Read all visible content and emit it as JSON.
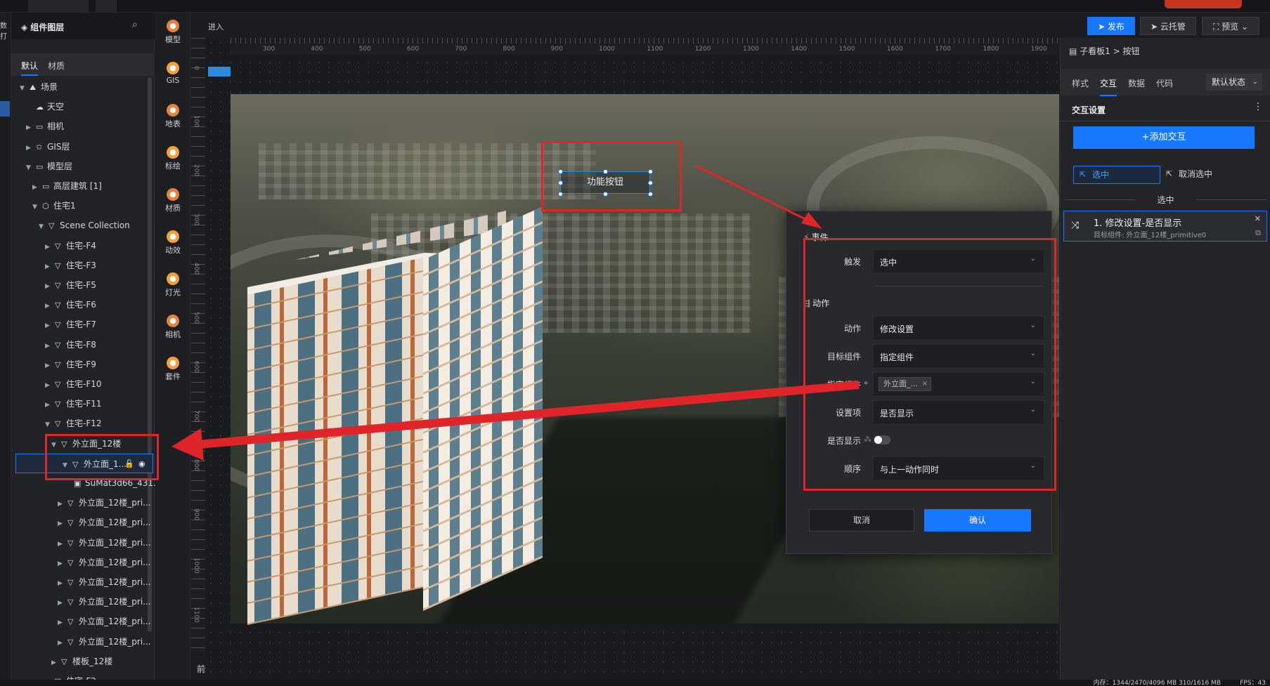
{
  "top": {
    "badge": ""
  },
  "left_strip": {
    "label": "数打"
  },
  "layer_panel": {
    "title": "组件图层",
    "tabs": [
      "默认",
      "材质"
    ],
    "tree": [
      {
        "label": "场景",
        "icon": "scene-icon",
        "indent": 0,
        "arrow": "down"
      },
      {
        "label": "天空",
        "icon": "sky-icon",
        "indent": 1,
        "arrow": ""
      },
      {
        "label": "相机",
        "icon": "folder-icon",
        "indent": 1,
        "arrow": "right"
      },
      {
        "label": "GIS层",
        "icon": "gis-icon",
        "indent": 1,
        "arrow": "right"
      },
      {
        "label": "模型层",
        "icon": "folder-icon",
        "indent": 1,
        "arrow": "down"
      },
      {
        "label": "高层建筑 [1]",
        "icon": "folder-icon",
        "indent": 2,
        "arrow": "right"
      },
      {
        "label": "住宅1",
        "icon": "model-icon",
        "indent": 2,
        "arrow": "down"
      },
      {
        "label": "Scene Collection",
        "icon": "collection-icon",
        "indent": 3,
        "arrow": "down"
      },
      {
        "label": "住宅-F4",
        "icon": "collection-icon",
        "indent": 4,
        "arrow": "right"
      },
      {
        "label": "住宅-F3",
        "icon": "collection-icon",
        "indent": 4,
        "arrow": "right"
      },
      {
        "label": "住宅-F5",
        "icon": "collection-icon",
        "indent": 4,
        "arrow": "right"
      },
      {
        "label": "住宅-F6",
        "icon": "collection-icon",
        "indent": 4,
        "arrow": "right"
      },
      {
        "label": "住宅-F7",
        "icon": "collection-icon",
        "indent": 4,
        "arrow": "right"
      },
      {
        "label": "住宅-F8",
        "icon": "collection-icon",
        "indent": 4,
        "arrow": "right"
      },
      {
        "label": "住宅-F9",
        "icon": "collection-icon",
        "indent": 4,
        "arrow": "right"
      },
      {
        "label": "住宅-F10",
        "icon": "collection-icon",
        "indent": 4,
        "arrow": "right"
      },
      {
        "label": "住宅-F11",
        "icon": "collection-icon",
        "indent": 4,
        "arrow": "right"
      },
      {
        "label": "住宅-F12",
        "icon": "collection-icon",
        "indent": 4,
        "arrow": "down"
      },
      {
        "label": "外立面_12楼",
        "icon": "collection-icon",
        "indent": 5,
        "arrow": "down"
      },
      {
        "label": "外立面_1...",
        "icon": "collection-icon",
        "indent": 6,
        "arrow": "down",
        "selected": true
      },
      {
        "label": "SuMat3d66_431...",
        "icon": "material-icon",
        "indent": 7,
        "arrow": ""
      },
      {
        "label": "外立面_12楼_pri...",
        "icon": "collection-icon",
        "indent": 6,
        "arrow": "right"
      },
      {
        "label": "外立面_12楼_pri...",
        "icon": "collection-icon",
        "indent": 6,
        "arrow": "right"
      },
      {
        "label": "外立面_12楼_pri...",
        "icon": "collection-icon",
        "indent": 6,
        "arrow": "right"
      },
      {
        "label": "外立面_12楼_pri...",
        "icon": "collection-icon",
        "indent": 6,
        "arrow": "right"
      },
      {
        "label": "外立面_12楼_pri...",
        "icon": "collection-icon",
        "indent": 6,
        "arrow": "right"
      },
      {
        "label": "外立面_12楼_pri...",
        "icon": "collection-icon",
        "indent": 6,
        "arrow": "right"
      },
      {
        "label": "外立面_12楼_pri...",
        "icon": "collection-icon",
        "indent": 6,
        "arrow": "right"
      },
      {
        "label": "外立面_12楼_pri...",
        "icon": "collection-icon",
        "indent": 6,
        "arrow": "right"
      },
      {
        "label": "楼板_12楼",
        "icon": "collection-icon",
        "indent": 5,
        "arrow": "right"
      },
      {
        "label": "住宅-F2",
        "icon": "collection-icon",
        "indent": 4,
        "arrow": "right"
      }
    ]
  },
  "toolbar": {
    "items": [
      {
        "label": "模型",
        "icon": "model-tool-icon",
        "color": "#e8803a"
      },
      {
        "label": "GIS",
        "icon": "gis-tool-icon",
        "color": "#f0a13c"
      },
      {
        "label": "地表",
        "icon": "terrain-tool-icon",
        "color": "#e8803a"
      },
      {
        "label": "标绘",
        "icon": "marker-tool-icon",
        "color": "#f0a13c"
      },
      {
        "label": "材质",
        "icon": "material-tool-icon",
        "color": "#e8803a"
      },
      {
        "label": "动效",
        "icon": "effect-tool-icon",
        "color": "#f0a13c"
      },
      {
        "label": "灯光",
        "icon": "light-tool-icon",
        "color": "#f0a13c"
      },
      {
        "label": "相机",
        "icon": "camera-tool-icon",
        "color": "#e8803a"
      },
      {
        "label": "套件",
        "icon": "kit-tool-icon",
        "color": "#f0a13c"
      }
    ]
  },
  "mini_panel": {
    "title": "进入",
    "footer": "前景"
  },
  "rulers": {
    "h_labels": [
      "300",
      "400",
      "500",
      "600",
      "700",
      "800",
      "900",
      "1000",
      "1100",
      "1200",
      "1300",
      "1400",
      "1500",
      "1600",
      "1700",
      "1800",
      "1900"
    ],
    "v_labels": [
      "0",
      "100",
      "200",
      "300",
      "400",
      "500",
      "600",
      "700",
      "800",
      "900",
      "1000",
      "1100"
    ]
  },
  "canvas": {
    "function_button": "功能按钮"
  },
  "dialog": {
    "event_section": "事件",
    "action_section": "动作",
    "fields": {
      "trigger": {
        "label": "触发",
        "value": "选中"
      },
      "action": {
        "label": "动作",
        "value": "修改设置"
      },
      "target": {
        "label": "目标组件",
        "value": "指定组件"
      },
      "specified": {
        "label": "指定组件",
        "tag": "外立面_..."
      },
      "setting": {
        "label": "设置项",
        "value": "是否显示"
      },
      "show": {
        "label": "是否显示",
        "state": "off"
      },
      "order": {
        "label": "顺序",
        "value": "与上一动作同时"
      }
    },
    "cancel": "取消",
    "confirm": "确认"
  },
  "actions": {
    "publish": "发布",
    "cloud": "云托管",
    "preview": "预览"
  },
  "right_panel": {
    "breadcrumb": "子看板1 > 按钮",
    "tabs": [
      "样式",
      "交互",
      "数据",
      "代码"
    ],
    "active_tab": "交互",
    "state": "默认状态",
    "section_title": "交互设置",
    "add_button": "+添加交互",
    "select_option": "选中",
    "deselect_option": "取消选中",
    "group_label": "选中",
    "action_card": {
      "title": "1. 修改设置-是否显示",
      "subtitle": "目标组件: 外立面_12楼_primitive0"
    }
  },
  "status": {
    "memory": "内存：1344/2470/4096 MB  310/1616 MB",
    "fps": "FPS：43"
  },
  "colors": {
    "accent": "#1677ff",
    "highlight_red": "#e0252a",
    "panel": "#232428"
  }
}
